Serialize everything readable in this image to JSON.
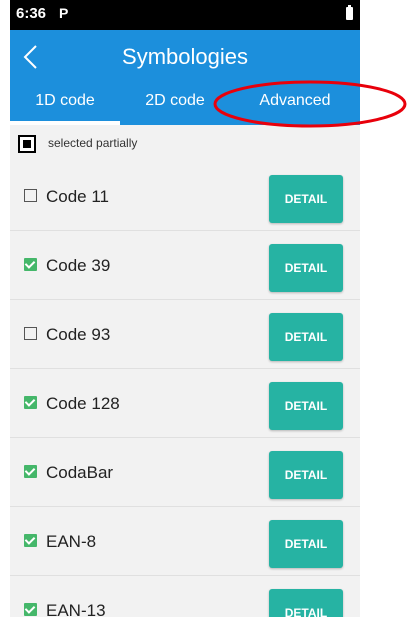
{
  "status_bar": {
    "time": "6:36",
    "notification_icon": "P",
    "battery_icon": "battery-icon"
  },
  "app_bar": {
    "title": "Symbologies",
    "back_icon": "chevron-left-icon"
  },
  "tabs": [
    {
      "label": "1D code",
      "selected": true
    },
    {
      "label": "2D code",
      "selected": false
    },
    {
      "label": "Advanced",
      "selected": false
    }
  ],
  "select_all": {
    "label": "selected partially",
    "state": "partial"
  },
  "symbologies": [
    {
      "name": "Code 11",
      "checked": false,
      "button": "DETAIL"
    },
    {
      "name": "Code 39",
      "checked": true,
      "button": "DETAIL"
    },
    {
      "name": "Code 93",
      "checked": false,
      "button": "DETAIL"
    },
    {
      "name": "Code 128",
      "checked": true,
      "button": "DETAIL"
    },
    {
      "name": "CodaBar",
      "checked": true,
      "button": "DETAIL"
    },
    {
      "name": "EAN-8",
      "checked": true,
      "button": "DETAIL"
    },
    {
      "name": "EAN-13",
      "checked": true,
      "button": "DETAIL"
    }
  ],
  "colors": {
    "primary": "#1c8fdc",
    "detail_button": "#26b3a3",
    "checkbox_checked": "#45b76a",
    "annotation": "#e8000b"
  }
}
